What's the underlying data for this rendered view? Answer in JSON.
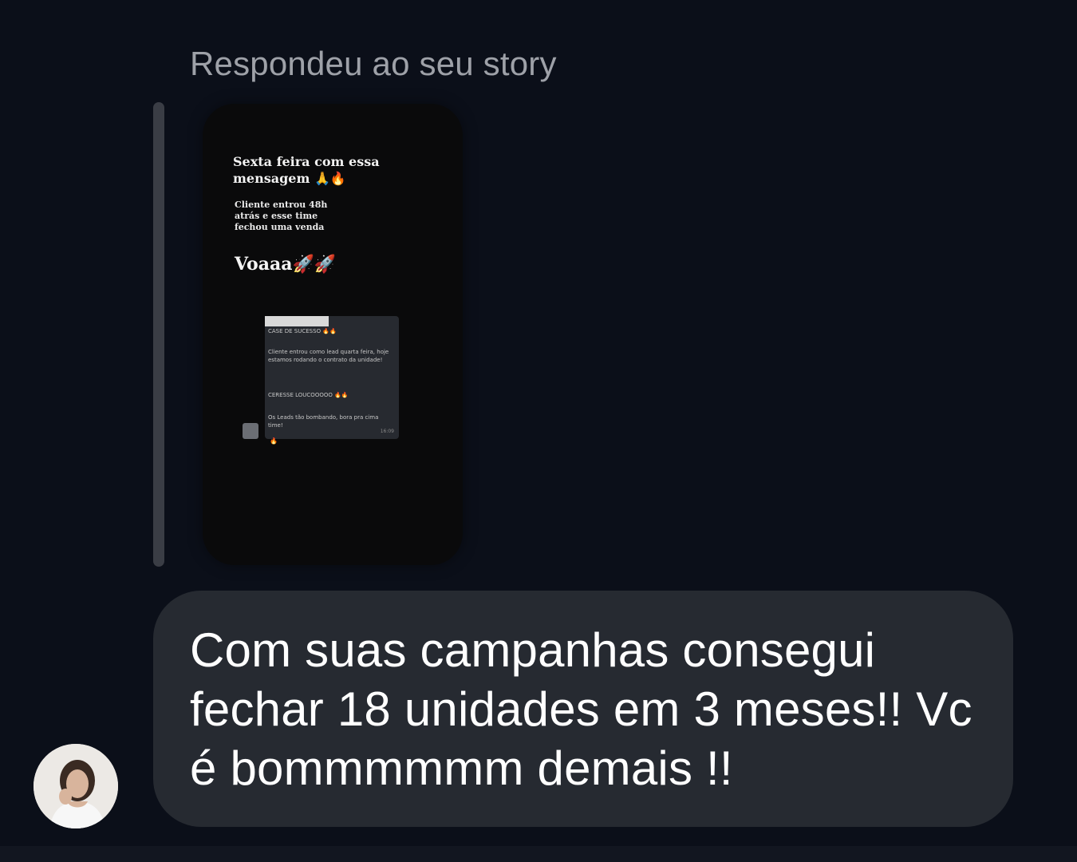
{
  "reply_label": "Respondeu ao seu story",
  "story": {
    "title": "Sexta feira com essa mensagem 🙏🔥",
    "subtitle": "Cliente entrou 48h atrás e esse time fechou uma venda",
    "headline": "Voaaa🚀🚀",
    "screenshot": {
      "header": "CASE DE SUCESSO 🔥🔥",
      "line1": "Cliente entrou como lead quarta feira, hoje estamos rodando o contrato da unidade!",
      "line2": "CERESSE LOUCOOOOO 🔥🔥",
      "line3": "Os Leads tão bombando, bora pra cima time!",
      "time": "16:09",
      "reaction": "🔥"
    }
  },
  "message": {
    "text": "Com suas campanhas consegui fechar 18 unidades em 3 meses!! Vc é bommmmmm demais !!"
  },
  "colors": {
    "background": "#0b0f19",
    "bubble": "#262a31",
    "label": "#9ea1a8",
    "quote_bar": "#3a3d45"
  },
  "icons": {
    "avatar": "profile-photo-avatar"
  }
}
